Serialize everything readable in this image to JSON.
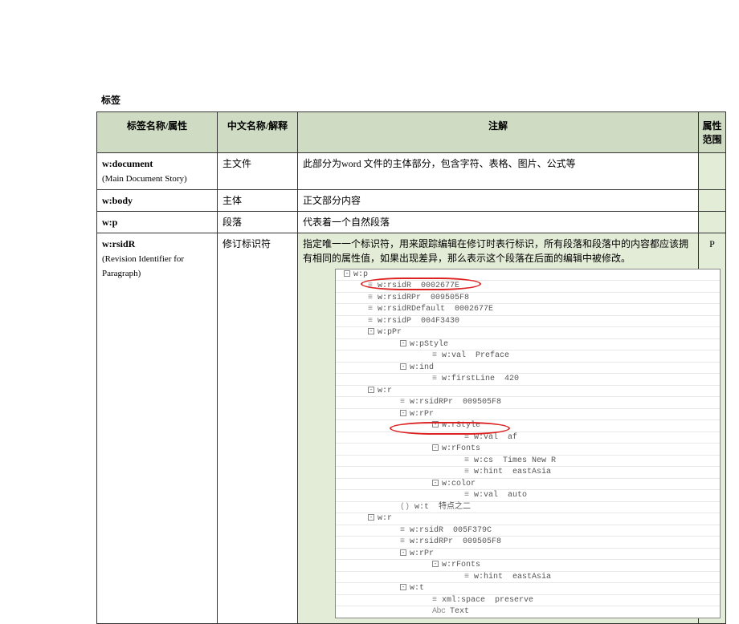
{
  "title": "标签",
  "headers": {
    "name": "标签名称/属性",
    "zh": "中文名称/解释",
    "note": "注解",
    "scope": "属性\n范围"
  },
  "rows": [
    {
      "name": "w:document",
      "sub": "(Main Document Story)",
      "zh": "主文件",
      "note": "此部分为word 文件的主体部分，包含字符、表格、图片、公式等"
    },
    {
      "name": "w:body",
      "zh": "主体",
      "note": "正文部分内容"
    },
    {
      "name": "w:p",
      "zh": "段落",
      "note": "代表着一个自然段落"
    },
    {
      "name": "w:rsidR",
      "sub": "(Revision Identifier for Paragraph)",
      "zh": "修订标识符",
      "note": "指定唯一一个标识符，用来跟踪编辑在修订时表行标识，所有段落和段落中的内容都应该拥有相同的属性值，如果出现差异，那么表示这个段落在后面的编辑中被修改。",
      "scope": "P"
    }
  ],
  "tree": {
    "r0": "w:p",
    "r1_l": "w:rsidR",
    "r1_v": "0002677E",
    "r2_l": "w:rsidRPr",
    "r2_v": "009505F8",
    "r3_l": "w:rsidRDefault",
    "r3_v": "0002677E",
    "r4_l": "w:rsidP",
    "r4_v": "004F3430",
    "r5": "w:pPr",
    "r6": "w:pStyle",
    "r7_l": "w:val",
    "r7_v": "Preface",
    "r8": "w:ind",
    "r9_l": "w:firstLine",
    "r9_v": "420",
    "r10": "w:r",
    "r11_l": "w:rsidRPr",
    "r11_v": "009505F8",
    "r12": "w:rPr",
    "r13": "w:rStyle",
    "r14_l": "w:val",
    "r14_v": "af",
    "r15": "w:rFonts",
    "r16_l": "w:cs",
    "r16_v": "Times New R",
    "r17_l": "w:hint",
    "r17_v": "eastAsia",
    "r18": "w:color",
    "r19_l": "w:val",
    "r19_v": "auto",
    "r20_l": "w:t",
    "r20_v": "特点之二",
    "r21": "w:r",
    "r22_l": "w:rsidR",
    "r22_v": "005F379C",
    "r23_l": "w:rsidRPr",
    "r23_v": "009505F8",
    "r24": "w:rPr",
    "r25": "w:rFonts",
    "r26_l": "w:hint",
    "r26_v": "eastAsia",
    "r27": "w:t",
    "r28_l": "xml:space",
    "r28_v": "preserve",
    "r29": "Text"
  }
}
